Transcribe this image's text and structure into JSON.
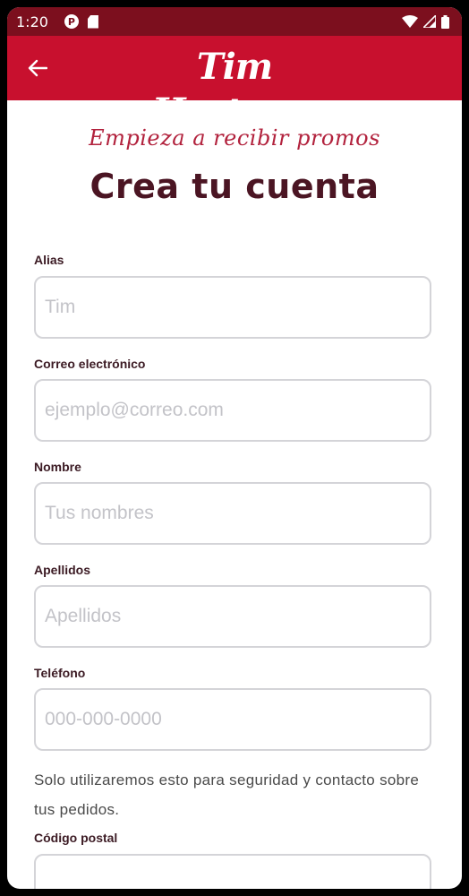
{
  "status_bar": {
    "time": "1:20",
    "left_icons": [
      "circle-p-icon",
      "sd-card-icon"
    ],
    "right_icons": [
      "wifi-icon",
      "signal-icon",
      "battery-icon"
    ]
  },
  "app_bar": {
    "back_icon": "arrow-left-icon",
    "logo_text": "Tim Hortons",
    "logo_mark": "®"
  },
  "content": {
    "tagline": "Empieza a recibir promos",
    "title": "Crea tu cuenta",
    "fields": [
      {
        "label": "Alias",
        "placeholder": "Tim",
        "value": ""
      },
      {
        "label": "Correo electrónico",
        "placeholder": "ejemplo@correo.com",
        "value": ""
      },
      {
        "label": "Nombre",
        "placeholder": "Tus nombres",
        "value": ""
      },
      {
        "label": "Apellidos",
        "placeholder": "Apellidos",
        "value": ""
      },
      {
        "label": "Teléfono",
        "placeholder": "000-000-0000",
        "value": ""
      },
      {
        "label": "Código postal",
        "placeholder": "",
        "value": ""
      }
    ],
    "phone_helper": "Solo utilizaremos esto para seguridad y contacto sobre tus pedidos."
  },
  "colors": {
    "status_bar": "#7c0f1e",
    "brand_red": "#c8102e",
    "tagline": "#b2223d",
    "title": "#4b1523",
    "label": "#3c1b24",
    "input_border": "#d4d4d8",
    "placeholder": "#c3c3c8"
  }
}
